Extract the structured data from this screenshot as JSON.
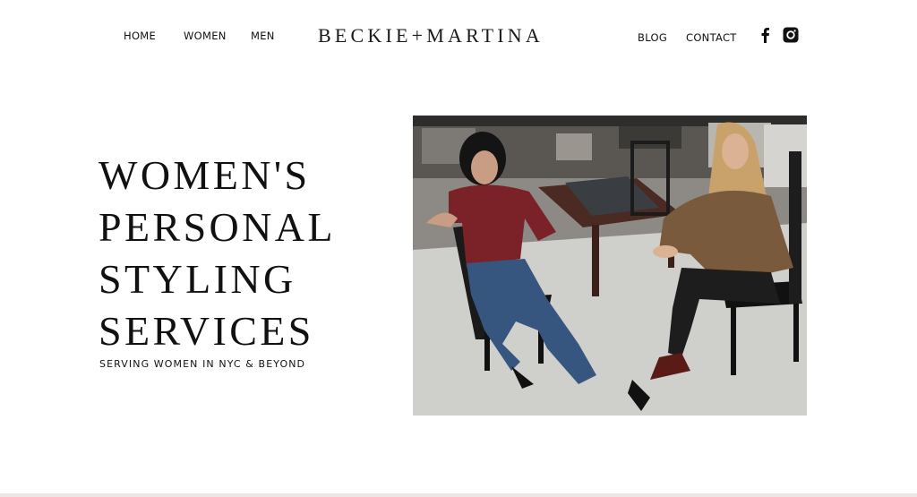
{
  "nav": {
    "left": [
      "HOME",
      "WOMEN",
      "MEN"
    ],
    "right": [
      "BLOG",
      "CONTACT"
    ],
    "logo": "BECKIE+MARTINA"
  },
  "social": {
    "icons": [
      "facebook-icon",
      "instagram-icon"
    ]
  },
  "hero": {
    "title_lines": [
      "WOMEN'S",
      "PERSONAL",
      "STYLING",
      "SERVICES"
    ],
    "subtitle": "SERVING WOMEN IN NYC & BEYOND"
  },
  "colors": {
    "accent_bar": "#f1e4e4",
    "text": "#111111"
  }
}
